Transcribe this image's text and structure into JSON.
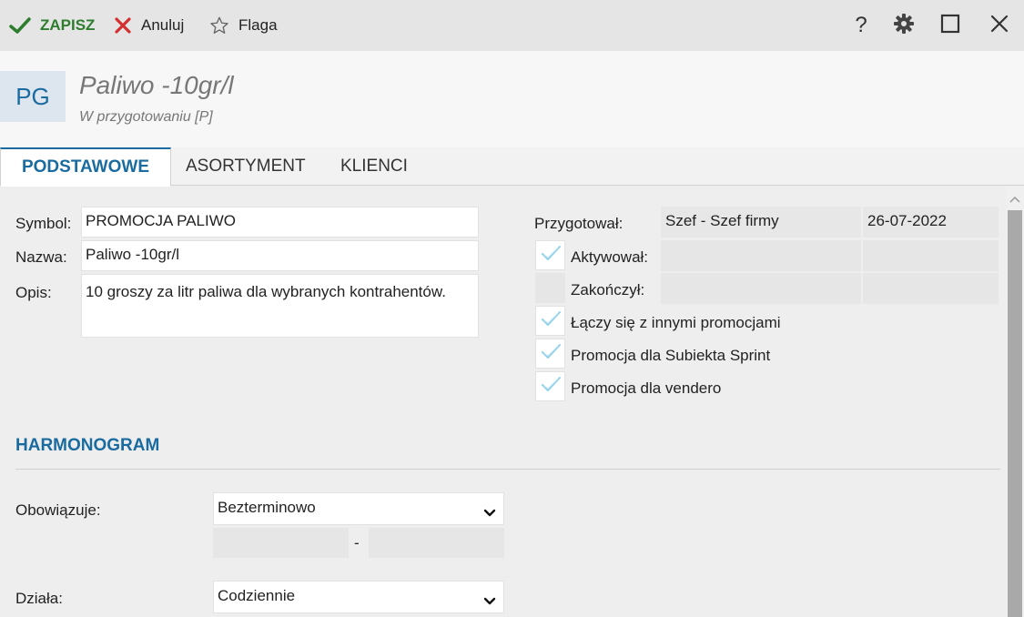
{
  "toolbar": {
    "save_label": "ZAPISZ",
    "cancel_label": "Anuluj",
    "flag_label": "Flaga",
    "help_label": "?"
  },
  "header": {
    "avatar": "PG",
    "title": "Paliwo -10gr/l",
    "subtitle": "W przygotowaniu [P]"
  },
  "tabs": [
    {
      "label": "PODSTAWOWE",
      "active": true
    },
    {
      "label": "ASORTYMENT",
      "active": false
    },
    {
      "label": "KLIENCI",
      "active": false
    }
  ],
  "form": {
    "symbol_label": "Symbol:",
    "symbol_value": "PROMOCJA PALIWO",
    "name_label": "Nazwa:",
    "name_value": "Paliwo -10gr/l",
    "desc_label": "Opis:",
    "desc_value": "10 groszy za litr paliwa dla wybranych kontrahentów.",
    "prepared_label": "Przygotował:",
    "prepared_by": "Szef - Szef firmy",
    "prepared_date": "26-07-2022",
    "activated_label": "Aktywował:",
    "activated_by": "",
    "activated_date": "",
    "finished_label": "Zakończył:",
    "finished_by": "",
    "finished_date": "",
    "combine_label": "Łączy się z innymi promocjami",
    "sprint_label": "Promocja dla Subiekta Sprint",
    "vendero_label": "Promocja dla vendero"
  },
  "schedule": {
    "title": "HARMONOGRAM",
    "valid_label": "Obowiązuje:",
    "valid_value": "Bezterminowo",
    "date_from": "",
    "date_sep": "-",
    "date_to": "",
    "works_label": "Działa:",
    "works_value": "Codziennie"
  },
  "colors": {
    "accent": "#1a6ba0",
    "save": "#2e7d2e",
    "cancel": "#d32f2f",
    "check": "#7ec8e3"
  }
}
